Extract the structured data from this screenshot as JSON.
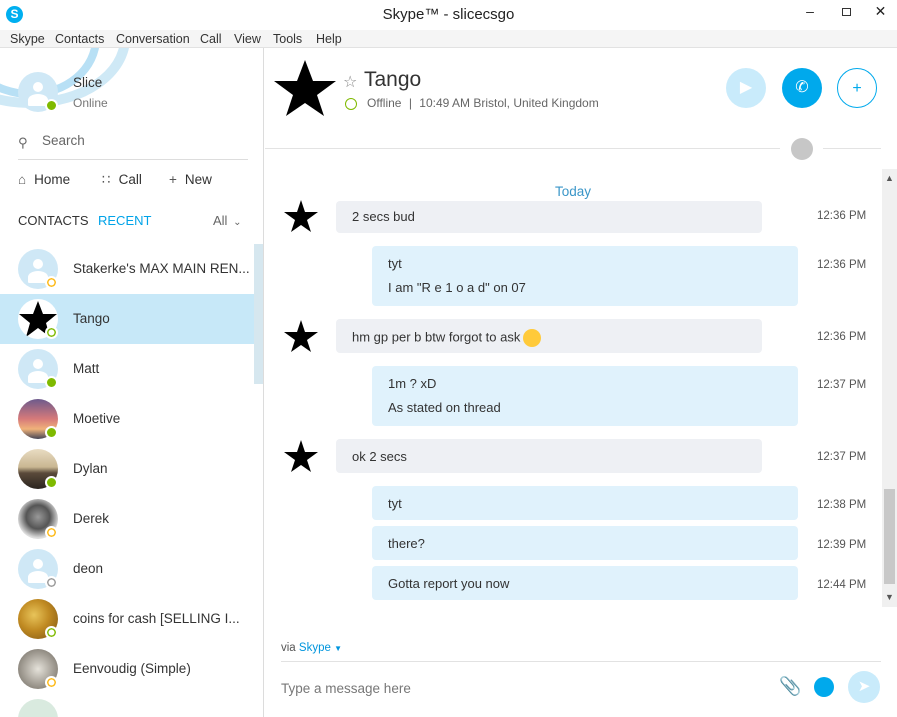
{
  "window": {
    "title": "Skype™ - slicecsgo",
    "app_icon": "skype-logo-icon"
  },
  "menu": [
    "Skype",
    "Contacts",
    "Conversation",
    "Call",
    "View",
    "Tools",
    "Help"
  ],
  "self": {
    "name": "Slice",
    "status": "Online"
  },
  "search": {
    "placeholder": "Search"
  },
  "nav": {
    "home": "Home",
    "call": "Call",
    "new": "New"
  },
  "tabs": {
    "contacts": "CONTACTS",
    "recent": "RECENT",
    "all": "All"
  },
  "contacts": [
    {
      "name": "Stakerke's MAX MAIN REN...",
      "status": "away",
      "avatar": "default"
    },
    {
      "name": "Tango",
      "status": "offline",
      "avatar": "star",
      "selected": true
    },
    {
      "name": "Matt",
      "status": "online",
      "avatar": "default"
    },
    {
      "name": "Moetive",
      "status": "online",
      "avatar": "photo-sunset"
    },
    {
      "name": "Dylan",
      "status": "online",
      "avatar": "photo-dylan"
    },
    {
      "name": "Derek",
      "status": "away",
      "avatar": "photo-derek"
    },
    {
      "name": "deon",
      "status": "unknown",
      "avatar": "default"
    },
    {
      "name": "coins for cash [SELLING I...",
      "status": "offline",
      "avatar": "photo-coins"
    },
    {
      "name": "Eenvoudig (Simple)",
      "status": "away",
      "avatar": "photo-koala"
    }
  ],
  "conversation": {
    "title": "Tango",
    "status": "Offline",
    "local_time": "10:49 AM Bristol, United Kingdom",
    "day_separator": "Today",
    "messages": [
      {
        "dir": "in",
        "lines": [
          "2 secs bud"
        ],
        "time": "12:36 PM"
      },
      {
        "dir": "out",
        "lines": [
          "tyt",
          "I am \"R e 1 o a d\" on 07"
        ],
        "time": "12:36 PM"
      },
      {
        "dir": "in",
        "lines": [
          "hm gp per b btw forgot to ask"
        ],
        "time": "12:36 PM"
      },
      {
        "dir": "out",
        "lines": [
          "1m ? xD",
          "As stated on thread"
        ],
        "time": "12:37 PM"
      },
      {
        "dir": "in",
        "lines": [
          "ok 2 secs"
        ],
        "time": "12:37 PM"
      },
      {
        "dir": "out",
        "lines": [
          "tyt"
        ],
        "time": "12:38 PM"
      },
      {
        "dir": "out",
        "lines": [
          "there?"
        ],
        "time": "12:39 PM"
      },
      {
        "dir": "out",
        "lines": [
          "Gotta report you now"
        ],
        "time": "12:44 PM"
      }
    ],
    "via_prefix": "via",
    "via_service": "Skype",
    "composer_placeholder": "Type a message here"
  },
  "colors": {
    "accent": "#00a9ec",
    "online": "#7fba00",
    "away": "#fdb813",
    "selected_row": "#c7e8f8",
    "bubble_out": "#e0f2fc",
    "bubble_in": "#eef0f4"
  }
}
